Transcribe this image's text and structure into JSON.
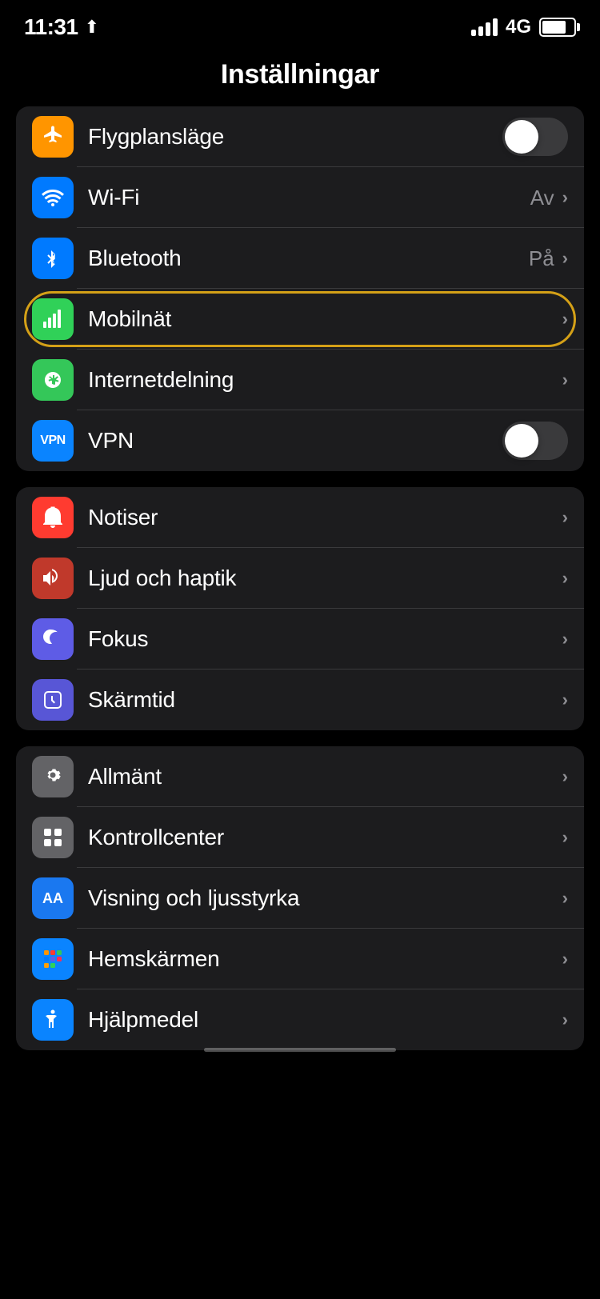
{
  "statusBar": {
    "time": "11:31",
    "network": "4G",
    "hasLocation": true
  },
  "pageTitle": "Inställningar",
  "groups": [
    {
      "id": "connectivity",
      "rows": [
        {
          "id": "flygplansläge",
          "label": "Flygplansläge",
          "iconBg": "bg-orange",
          "iconType": "airplane",
          "control": "toggle",
          "toggleState": "off",
          "value": "",
          "hasChevron": false
        },
        {
          "id": "wifi",
          "label": "Wi-Fi",
          "iconBg": "bg-blue",
          "iconType": "wifi",
          "control": "value-chevron",
          "value": "Av",
          "hasChevron": true
        },
        {
          "id": "bluetooth",
          "label": "Bluetooth",
          "iconBg": "bg-blue",
          "iconType": "bluetooth",
          "control": "value-chevron",
          "value": "På",
          "hasChevron": true
        },
        {
          "id": "mobilnät",
          "label": "Mobilnät",
          "iconBg": "bg-green-mobile",
          "iconType": "cellular",
          "control": "chevron",
          "value": "",
          "hasChevron": true,
          "highlighted": true
        },
        {
          "id": "internetdelning",
          "label": "Internetdelning",
          "iconBg": "bg-green",
          "iconType": "hotspot",
          "control": "chevron",
          "value": "",
          "hasChevron": true
        },
        {
          "id": "vpn",
          "label": "VPN",
          "iconBg": "bg-blue-royal",
          "iconType": "vpn",
          "control": "toggle",
          "toggleState": "off",
          "value": "",
          "hasChevron": false
        }
      ]
    },
    {
      "id": "notifications",
      "rows": [
        {
          "id": "notiser",
          "label": "Notiser",
          "iconBg": "bg-red",
          "iconType": "bell",
          "control": "chevron",
          "hasChevron": true
        },
        {
          "id": "ljud",
          "label": "Ljud och haptik",
          "iconBg": "bg-red-dark",
          "iconType": "sound",
          "control": "chevron",
          "hasChevron": true
        },
        {
          "id": "fokus",
          "label": "Fokus",
          "iconBg": "bg-purple",
          "iconType": "moon",
          "control": "chevron",
          "hasChevron": true
        },
        {
          "id": "skärmtid",
          "label": "Skärmtid",
          "iconBg": "bg-purple-dark",
          "iconType": "screentime",
          "control": "chevron",
          "hasChevron": true
        }
      ]
    },
    {
      "id": "system",
      "rows": [
        {
          "id": "allmänt",
          "label": "Allmänt",
          "iconBg": "bg-gray",
          "iconType": "gear",
          "control": "chevron",
          "hasChevron": true
        },
        {
          "id": "kontrollcenter",
          "label": "Kontrollcenter",
          "iconBg": "bg-gray",
          "iconType": "controls",
          "control": "chevron",
          "hasChevron": true
        },
        {
          "id": "visning",
          "label": "Visning och ljusstyrka",
          "iconBg": "bg-blue",
          "iconType": "display",
          "control": "chevron",
          "hasChevron": true
        },
        {
          "id": "hemskärmen",
          "label": "Hemskärmen",
          "iconBg": "bg-blue-royal",
          "iconType": "homescreen",
          "control": "chevron",
          "hasChevron": true
        },
        {
          "id": "hjälpmedel",
          "label": "Hjälpmedel",
          "iconBg": "bg-blue",
          "iconType": "accessibility",
          "control": "chevron",
          "hasChevron": true
        }
      ]
    }
  ]
}
